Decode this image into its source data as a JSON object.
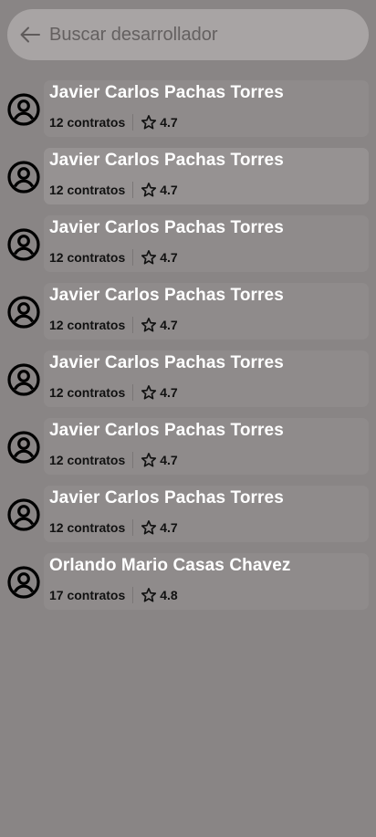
{
  "search": {
    "placeholder": "Buscar desarrollador",
    "back_icon": "arrow-left-icon"
  },
  "developers": [
    {
      "name": "Javier Carlos Pachas Torres",
      "contracts": "12 contratos",
      "rating": "4.7"
    },
    {
      "name": "Javier Carlos Pachas Torres",
      "contracts": "12 contratos",
      "rating": "4.7"
    },
    {
      "name": "Javier Carlos Pachas Torres",
      "contracts": "12 contratos",
      "rating": "4.7"
    },
    {
      "name": "Javier Carlos Pachas Torres",
      "contracts": "12 contratos",
      "rating": "4.7"
    },
    {
      "name": "Javier Carlos Pachas Torres",
      "contracts": "12 contratos",
      "rating": "4.7"
    },
    {
      "name": "Javier Carlos Pachas Torres",
      "contracts": "12 contratos",
      "rating": "4.7"
    },
    {
      "name": "Javier Carlos Pachas Torres",
      "contracts": "12 contratos",
      "rating": "4.7"
    },
    {
      "name": "Orlando Mario Casas Chavez",
      "contracts": "17 contratos",
      "rating": "4.8"
    }
  ],
  "icons": {
    "avatar": "account-circle-icon",
    "rating": "star-outline-icon"
  },
  "colors": {
    "background": "#898585",
    "search_bar": "#a8a4a4",
    "card": "#8f8b8b",
    "card_highlight": "#969292",
    "name_text": "#ffffff",
    "meta_text": "#111111"
  }
}
